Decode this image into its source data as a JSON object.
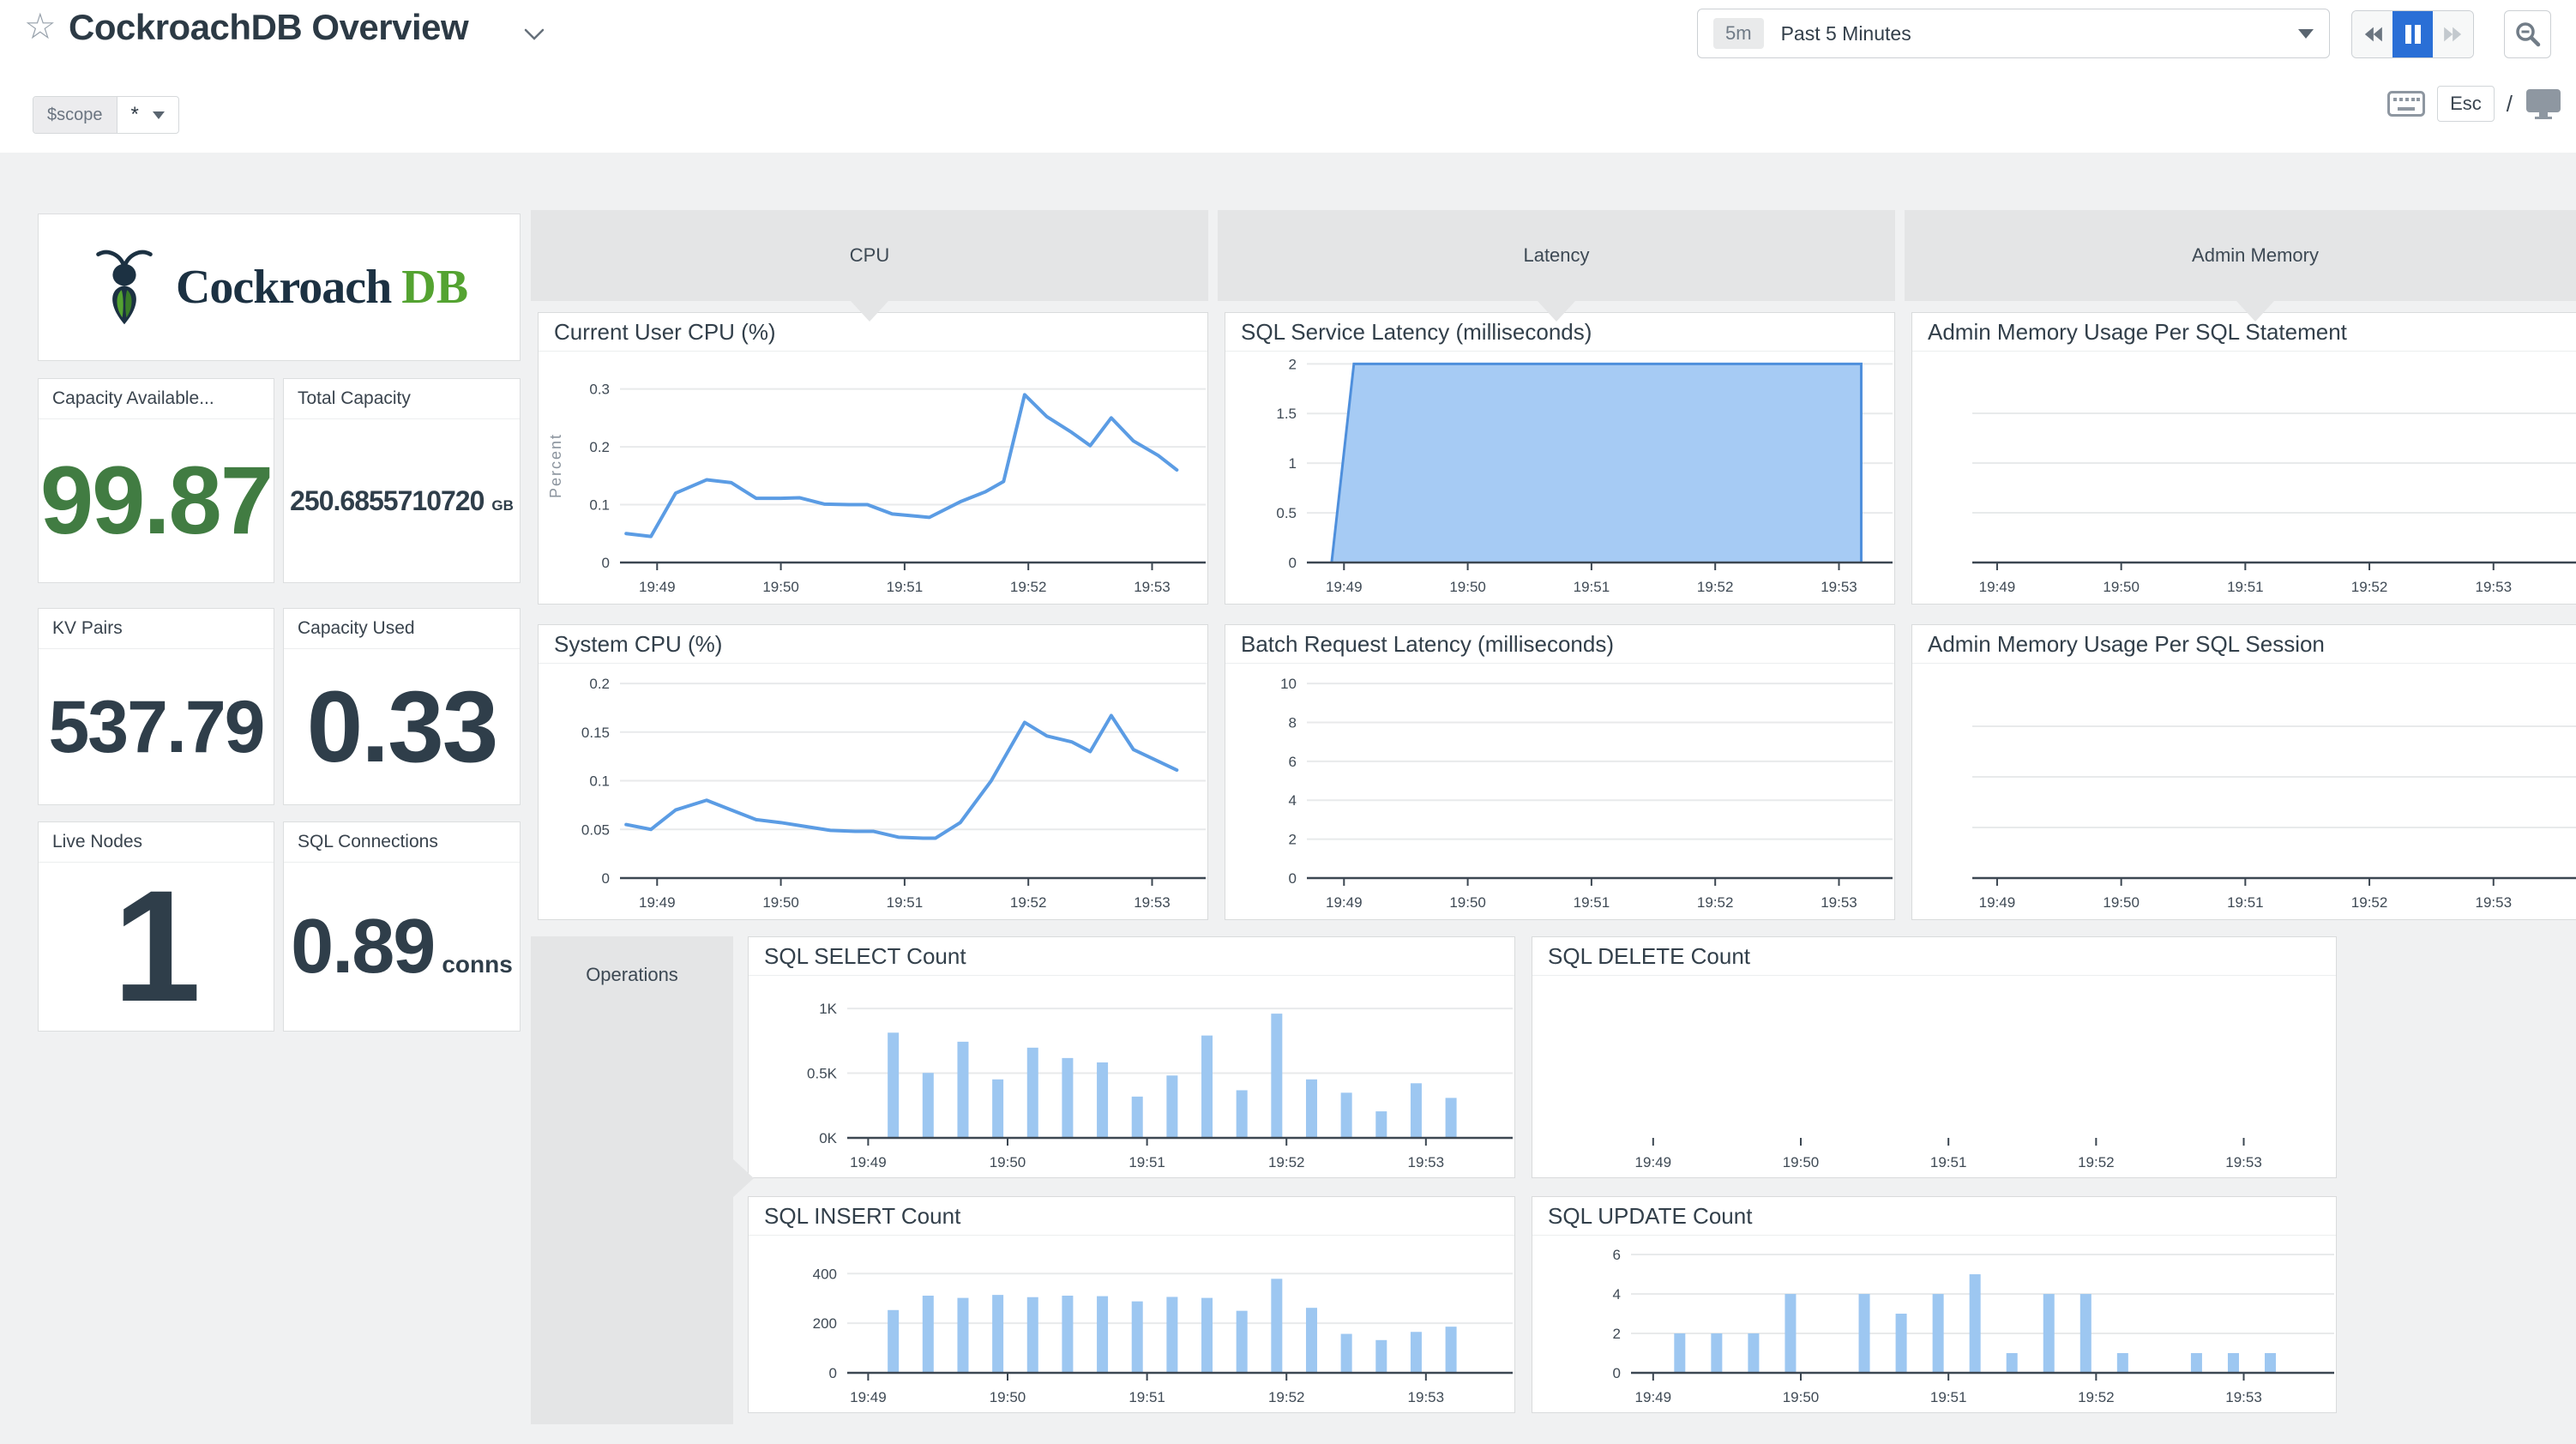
{
  "header": {
    "title": "CockroachDB Overview",
    "scope_label": "$scope",
    "scope_value": "*",
    "time_range_badge": "5m",
    "time_range_label": "Past 5 Minutes",
    "esc_label": "Esc",
    "slash": "/"
  },
  "logo": {
    "text_main": "Cockroach",
    "text_db": "DB"
  },
  "cards": [
    {
      "title": "Capacity Available...",
      "value": "99.87",
      "unit": ""
    },
    {
      "title": "Total Capacity",
      "value": "250.6855710720",
      "unit": "GB"
    },
    {
      "title": "KV Pairs",
      "value": "537.79",
      "unit": ""
    },
    {
      "title": "Capacity Used",
      "value": "0.33",
      "unit": ""
    },
    {
      "title": "Live Nodes",
      "value": "1",
      "unit": ""
    },
    {
      "title": "SQL Connections",
      "value": "0.89",
      "unit": "conns"
    }
  ],
  "groups": [
    {
      "label": "CPU"
    },
    {
      "label": "Latency"
    },
    {
      "label": "Admin Memory"
    },
    {
      "label": "Operations"
    }
  ],
  "colors": {
    "grid": "#e8eaeb",
    "axis": "#3c4752",
    "tick_text": "#3f4a55",
    "line_blue": "#5b9ce4",
    "area_fill": "#a6cbf4",
    "area_line": "#4e8fdc",
    "bar_blue": "#9dc7f1",
    "accent_blue": "#2a6fd6",
    "value_green": "#417c42",
    "logo_navy": "#1c3142",
    "logo_green": "#54a331"
  },
  "chart_data": [
    {
      "id": "current_user_cpu",
      "title": "Current User CPU (%)",
      "type": "line",
      "ylabel": "Percent",
      "ylim": [
        0,
        0.335
      ],
      "x_domain": [
        48.7,
        53.35
      ],
      "margins": {
        "l": 95,
        "r": 14,
        "t": 20,
        "b": 48
      },
      "y_ticks": [
        {
          "v": 0,
          "l": "0"
        },
        {
          "v": 0.1,
          "l": "0.1"
        },
        {
          "v": 0.2,
          "l": "0.2"
        },
        {
          "v": 0.3,
          "l": "0.3"
        }
      ],
      "x_ticks": [
        {
          "v": 49,
          "l": "19:49"
        },
        {
          "v": 50,
          "l": "19:50"
        },
        {
          "v": 51,
          "l": "19:51"
        },
        {
          "v": 52,
          "l": "19:52"
        },
        {
          "v": 53,
          "l": "19:53"
        }
      ],
      "points": [
        [
          48.75,
          0.05
        ],
        [
          48.95,
          0.045
        ],
        [
          49.15,
          0.12
        ],
        [
          49.4,
          0.143
        ],
        [
          49.6,
          0.138
        ],
        [
          49.8,
          0.111
        ],
        [
          50.0,
          0.111
        ],
        [
          50.15,
          0.112
        ],
        [
          50.35,
          0.101
        ],
        [
          50.55,
          0.1
        ],
        [
          50.7,
          0.1
        ],
        [
          50.9,
          0.084
        ],
        [
          51.1,
          0.08
        ],
        [
          51.2,
          0.078
        ],
        [
          51.45,
          0.105
        ],
        [
          51.65,
          0.122
        ],
        [
          51.8,
          0.14
        ],
        [
          51.97,
          0.29
        ],
        [
          52.15,
          0.252
        ],
        [
          52.35,
          0.225
        ],
        [
          52.5,
          0.202
        ],
        [
          52.67,
          0.25
        ],
        [
          52.85,
          0.21
        ],
        [
          53.05,
          0.185
        ],
        [
          53.2,
          0.16
        ]
      ]
    },
    {
      "id": "system_cpu",
      "title": "System CPU (%)",
      "type": "line",
      "ylim": [
        0,
        0.208
      ],
      "x_domain": [
        48.7,
        53.35
      ],
      "margins": {
        "l": 95,
        "r": 14,
        "t": 14,
        "b": 48
      },
      "y_ticks": [
        {
          "v": 0,
          "l": "0"
        },
        {
          "v": 0.05,
          "l": "0.05"
        },
        {
          "v": 0.1,
          "l": "0.1"
        },
        {
          "v": 0.15,
          "l": "0.15"
        },
        {
          "v": 0.2,
          "l": "0.2"
        }
      ],
      "x_ticks": [
        {
          "v": 49,
          "l": "19:49"
        },
        {
          "v": 50,
          "l": "19:50"
        },
        {
          "v": 51,
          "l": "19:51"
        },
        {
          "v": 52,
          "l": "19:52"
        },
        {
          "v": 53,
          "l": "19:53"
        }
      ],
      "points": [
        [
          48.75,
          0.055
        ],
        [
          48.95,
          0.05
        ],
        [
          49.15,
          0.07
        ],
        [
          49.4,
          0.08
        ],
        [
          49.6,
          0.07
        ],
        [
          49.8,
          0.06
        ],
        [
          50.0,
          0.057
        ],
        [
          50.2,
          0.053
        ],
        [
          50.4,
          0.049
        ],
        [
          50.6,
          0.048
        ],
        [
          50.75,
          0.048
        ],
        [
          50.95,
          0.042
        ],
        [
          51.15,
          0.041
        ],
        [
          51.25,
          0.041
        ],
        [
          51.45,
          0.057
        ],
        [
          51.7,
          0.1
        ],
        [
          51.97,
          0.16
        ],
        [
          52.15,
          0.146
        ],
        [
          52.35,
          0.14
        ],
        [
          52.5,
          0.13
        ],
        [
          52.67,
          0.167
        ],
        [
          52.85,
          0.132
        ],
        [
          53.05,
          0.12
        ],
        [
          53.2,
          0.111
        ]
      ]
    },
    {
      "id": "sql_service_latency",
      "title": "SQL Service Latency (milliseconds)",
      "type": "area",
      "ylim": [
        0,
        2.02
      ],
      "x_domain": [
        48.7,
        53.35
      ],
      "margins": {
        "l": 95,
        "r": 14,
        "t": 12,
        "b": 48
      },
      "y_ticks": [
        {
          "v": 0,
          "l": "0"
        },
        {
          "v": 0.5,
          "l": "0.5"
        },
        {
          "v": 1,
          "l": "1"
        },
        {
          "v": 1.5,
          "l": "1.5"
        },
        {
          "v": 2,
          "l": "2"
        }
      ],
      "x_ticks": [
        {
          "v": 49,
          "l": "19:49"
        },
        {
          "v": 50,
          "l": "19:50"
        },
        {
          "v": 51,
          "l": "19:51"
        },
        {
          "v": 52,
          "l": "19:52"
        },
        {
          "v": 53,
          "l": "19:53"
        }
      ],
      "points": [
        [
          48.9,
          0
        ],
        [
          49.08,
          2
        ],
        [
          53.18,
          2
        ],
        [
          53.18,
          0
        ]
      ]
    },
    {
      "id": "batch_request_latency",
      "title": "Batch Request Latency (milliseconds)",
      "type": "empty",
      "ylim": [
        0,
        10.4
      ],
      "x_domain": [
        48.7,
        53.35
      ],
      "margins": {
        "l": 95,
        "r": 14,
        "t": 14,
        "b": 48
      },
      "y_ticks": [
        {
          "v": 0,
          "l": "0"
        },
        {
          "v": 2,
          "l": "2"
        },
        {
          "v": 4,
          "l": "4"
        },
        {
          "v": 6,
          "l": "6"
        },
        {
          "v": 8,
          "l": "8"
        },
        {
          "v": 10,
          "l": "10"
        }
      ],
      "x_ticks": [
        {
          "v": 49,
          "l": "19:49"
        },
        {
          "v": 50,
          "l": "19:50"
        },
        {
          "v": 51,
          "l": "19:51"
        },
        {
          "v": 52,
          "l": "19:52"
        },
        {
          "v": 53,
          "l": "19:53"
        }
      ]
    },
    {
      "id": "admin_memory_statement",
      "title": "Admin Memory Usage Per SQL Statement",
      "type": "empty",
      "ylim": [
        0,
        1
      ],
      "x_domain": [
        48.8,
        53.9
      ],
      "gridcount": 3,
      "margins": {
        "l": 70,
        "r": 0,
        "t": 14,
        "b": 48
      },
      "x_ticks": [
        {
          "v": 49,
          "l": "19:49"
        },
        {
          "v": 50,
          "l": "19:50"
        },
        {
          "v": 51,
          "l": "19:51"
        },
        {
          "v": 52,
          "l": "19:52"
        },
        {
          "v": 53,
          "l": "19:53"
        }
      ]
    },
    {
      "id": "admin_memory_session",
      "title": "Admin Memory Usage Per SQL Session",
      "type": "empty",
      "ylim": [
        0,
        1
      ],
      "x_domain": [
        48.8,
        53.9
      ],
      "gridcount": 3,
      "margins": {
        "l": 70,
        "r": 0,
        "t": 14,
        "b": 48
      },
      "x_ticks": [
        {
          "v": 49,
          "l": "19:49"
        },
        {
          "v": 50,
          "l": "19:50"
        },
        {
          "v": 51,
          "l": "19:51"
        },
        {
          "v": 52,
          "l": "19:52"
        },
        {
          "v": 53,
          "l": "19:53"
        }
      ]
    },
    {
      "id": "sql_select_count",
      "title": "SQL SELECT Count",
      "type": "bars",
      "ylim": [
        0,
        1080
      ],
      "x_domain": [
        48.85,
        53.45
      ],
      "margins": {
        "l": 115,
        "r": 30,
        "t": 26,
        "b": 46
      },
      "y_ticks": [
        {
          "v": 0,
          "l": "0K"
        },
        {
          "v": 500,
          "l": "0.5K"
        },
        {
          "v": 1000,
          "l": "1K"
        }
      ],
      "x_ticks": [
        {
          "v": 49,
          "l": "19:49"
        },
        {
          "v": 50,
          "l": "19:50"
        },
        {
          "v": 51,
          "l": "19:51"
        },
        {
          "v": 52,
          "l": "19:52"
        },
        {
          "v": 53,
          "l": "19:53"
        }
      ],
      "bars": {
        "x_start": 49.18,
        "x_step": 0.25,
        "width": 13,
        "values": [
          813,
          502,
          743,
          452,
          697,
          617,
          583,
          319,
          482,
          791,
          368,
          960,
          452,
          349,
          205,
          422,
          309
        ]
      }
    },
    {
      "id": "sql_delete_count",
      "title": "SQL DELETE Count",
      "type": "empty",
      "ylim": [
        0,
        1
      ],
      "x_domain": [
        48.85,
        53.45
      ],
      "axis_line": false,
      "margins": {
        "l": 115,
        "r": 30,
        "t": 26,
        "b": 46
      },
      "x_ticks": [
        {
          "v": 49,
          "l": "19:49"
        },
        {
          "v": 50,
          "l": "19:50"
        },
        {
          "v": 51,
          "l": "19:51"
        },
        {
          "v": 52,
          "l": "19:52"
        },
        {
          "v": 53,
          "l": "19:53"
        }
      ]
    },
    {
      "id": "sql_insert_count",
      "title": "SQL INSERT Count",
      "type": "bars",
      "ylim": [
        0,
        470
      ],
      "x_domain": [
        48.85,
        53.45
      ],
      "margins": {
        "l": 115,
        "r": 30,
        "t": 24,
        "b": 46
      },
      "y_ticks": [
        {
          "v": 0,
          "l": "0"
        },
        {
          "v": 200,
          "l": "200"
        },
        {
          "v": 400,
          "l": "400"
        }
      ],
      "x_ticks": [
        {
          "v": 49,
          "l": "19:49"
        },
        {
          "v": 50,
          "l": "19:50"
        },
        {
          "v": 51,
          "l": "19:51"
        },
        {
          "v": 52,
          "l": "19:52"
        },
        {
          "v": 53,
          "l": "19:53"
        }
      ],
      "bars": {
        "x_start": 49.18,
        "x_step": 0.25,
        "width": 13,
        "values": [
          253,
          311,
          302,
          314,
          305,
          311,
          309,
          288,
          306,
          302,
          250,
          379,
          262,
          157,
          132,
          165,
          186
        ]
      }
    },
    {
      "id": "sql_update_count",
      "title": "SQL UPDATE Count",
      "type": "bars",
      "ylim": [
        0,
        6.35
      ],
      "x_domain": [
        48.85,
        53.45
      ],
      "margins": {
        "l": 115,
        "r": 30,
        "t": 14,
        "b": 46
      },
      "y_ticks": [
        {
          "v": 0,
          "l": "0"
        },
        {
          "v": 2,
          "l": "2"
        },
        {
          "v": 4,
          "l": "4"
        },
        {
          "v": 6,
          "l": "6"
        }
      ],
      "x_ticks": [
        {
          "v": 49,
          "l": "19:49"
        },
        {
          "v": 50,
          "l": "19:50"
        },
        {
          "v": 51,
          "l": "19:51"
        },
        {
          "v": 52,
          "l": "19:52"
        },
        {
          "v": 53,
          "l": "19:53"
        }
      ],
      "bars": {
        "x_start": 49.18,
        "x_step": 0.25,
        "width": 13,
        "values": [
          2,
          2,
          2,
          4,
          0,
          4,
          3,
          4,
          5,
          1,
          4,
          4,
          1,
          0,
          1,
          1,
          1
        ]
      }
    }
  ]
}
